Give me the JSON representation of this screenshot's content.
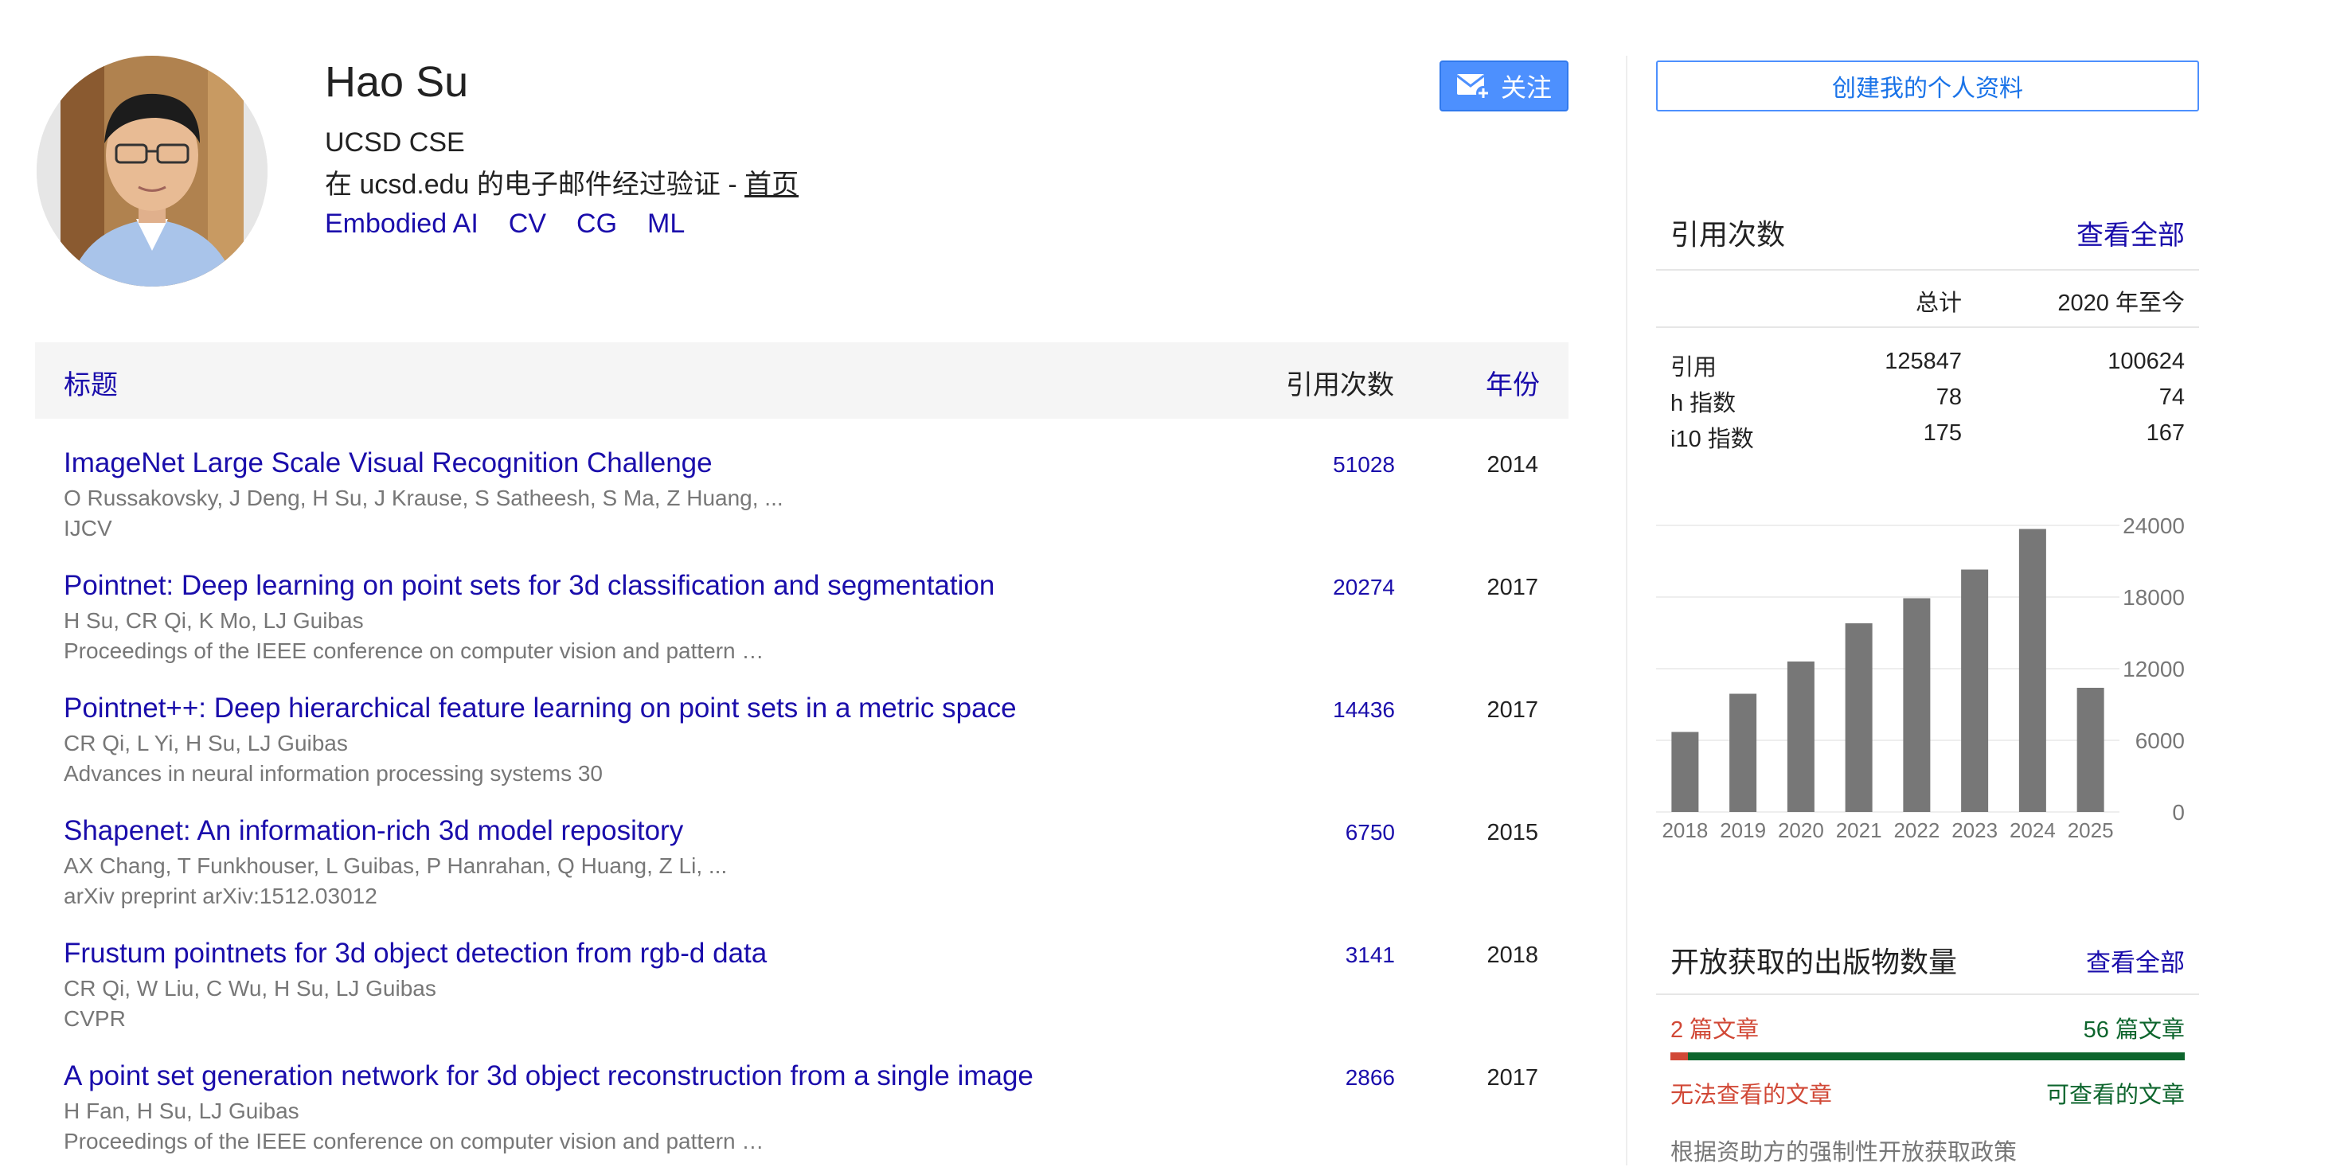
{
  "profile": {
    "name": "Hao Su",
    "affiliation": "UCSD CSE",
    "verified_prefix": "在 ucsd.edu 的电子邮件经过验证 - ",
    "homepage_label": "首页",
    "interests": [
      "Embodied AI",
      "CV",
      "CG",
      "ML"
    ],
    "follow_label": "关注"
  },
  "table": {
    "header_title": "标题",
    "header_cites": "引用次数",
    "header_year": "年份",
    "rows": [
      {
        "title": "ImageNet Large Scale Visual Recognition Challenge",
        "authors": "O Russakovsky, J Deng, H Su, J Krause, S Satheesh, S Ma, Z Huang, ...",
        "venue": "IJCV",
        "cites": "51028",
        "year": "2014"
      },
      {
        "title": "Pointnet: Deep learning on point sets for 3d classification and segmentation",
        "authors": "H Su, CR Qi, K Mo, LJ Guibas",
        "venue": "Proceedings of the IEEE conference on computer vision and pattern …",
        "cites": "20274",
        "year": "2017"
      },
      {
        "title": "Pointnet++: Deep hierarchical feature learning on point sets in a metric space",
        "authors": "CR Qi, L Yi, H Su, LJ Guibas",
        "venue": "Advances in neural information processing systems 30",
        "cites": "14436",
        "year": "2017"
      },
      {
        "title": "Shapenet: An information-rich 3d model repository",
        "authors": "AX Chang, T Funkhouser, L Guibas, P Hanrahan, Q Huang, Z Li, ...",
        "venue": "arXiv preprint arXiv:1512.03012",
        "cites": "6750",
        "year": "2015"
      },
      {
        "title": "Frustum pointnets for 3d object detection from rgb-d data",
        "authors": "CR Qi, W Liu, C Wu, H Su, LJ Guibas",
        "venue": "CVPR",
        "cites": "3141",
        "year": "2018"
      },
      {
        "title": "A point set generation network for 3d object reconstruction from a single image",
        "authors": "H Fan, H Su, LJ Guibas",
        "venue": "Proceedings of the IEEE conference on computer vision and pattern …",
        "cites": "2866",
        "year": "2017"
      }
    ]
  },
  "sidebar": {
    "create_profile_label": "创建我的个人资料",
    "citations": {
      "title": "引用次数",
      "view_all": "查看全部",
      "col_total": "总计",
      "col_since": "2020 年至今",
      "rows": [
        {
          "label": "引用",
          "total": "125847",
          "since": "100624"
        },
        {
          "label": "h 指数",
          "total": "78",
          "since": "74"
        },
        {
          "label": "i10 指数",
          "total": "175",
          "since": "167"
        }
      ]
    },
    "open_access": {
      "title": "开放获取的出版物数量",
      "view_all": "查看全部",
      "unavailable_count": "2 篇文章",
      "available_count": "56 篇文章",
      "unavailable_label": "无法查看的文章",
      "available_label": "可查看的文章",
      "available_fraction": 0.966,
      "mandate_text": "根据资助方的强制性开放获取政策"
    }
  },
  "colors": {
    "link": "#1a0dab",
    "follow_bg": "#4d90fe",
    "bar": "#777777",
    "oa_red": "#d14836",
    "oa_green": "#0d652d"
  },
  "chart_data": {
    "type": "bar",
    "categories": [
      "2018",
      "2019",
      "2020",
      "2021",
      "2022",
      "2023",
      "2024",
      "2025"
    ],
    "values": [
      6700,
      9900,
      12600,
      15800,
      17900,
      20300,
      23700,
      10400
    ],
    "ylim": [
      0,
      24000
    ],
    "yticks": [
      "0",
      "6000",
      "12000",
      "18000",
      "24000"
    ],
    "grid": true
  }
}
